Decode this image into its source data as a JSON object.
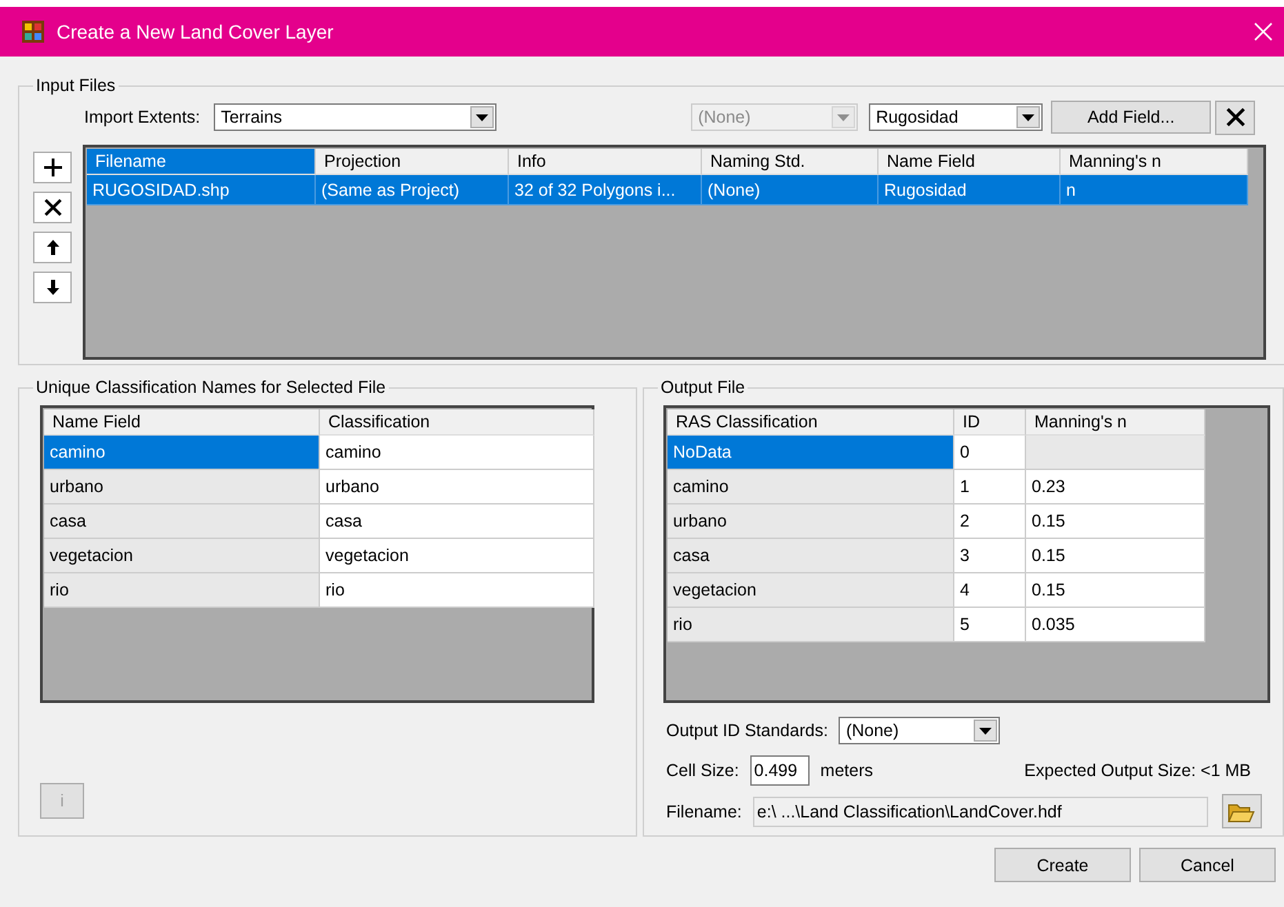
{
  "window": {
    "title": "Create a New Land Cover Layer"
  },
  "input_files": {
    "title": "Input Files",
    "import_extents": {
      "label": "Import Extents:",
      "value": "Terrains"
    },
    "naming_std": {
      "value": "(None)",
      "disabled": true
    },
    "name_field": {
      "value": "Rugosidad",
      "disabled": false
    },
    "add_field_button": "Add Field...",
    "columns": [
      {
        "label": "Filename",
        "selected": true
      },
      {
        "label": "Projection",
        "selected": false
      },
      {
        "label": "Info",
        "selected": false
      },
      {
        "label": "Naming Std.",
        "selected": false
      },
      {
        "label": "Name Field",
        "selected": false
      },
      {
        "label": "Manning's n",
        "selected": false
      }
    ],
    "rows": [
      {
        "cells": [
          "RUGOSIDAD.shp",
          "(Same as Project)",
          "32 of 32 Polygons i...",
          "(None)",
          "Rugosidad",
          "n"
        ],
        "selected": true
      }
    ]
  },
  "classification_names": {
    "title": "Unique Classification Names for Selected File",
    "columns": [
      "Name Field",
      "Classification"
    ],
    "rows": [
      {
        "cells": [
          "camino",
          "camino"
        ],
        "selected": true
      },
      {
        "cells": [
          "urbano",
          "urbano"
        ],
        "selected": false
      },
      {
        "cells": [
          "casa",
          "casa"
        ],
        "selected": false
      },
      {
        "cells": [
          "vegetacion",
          "vegetacion"
        ],
        "selected": false
      },
      {
        "cells": [
          "rio",
          "rio"
        ],
        "selected": false
      }
    ],
    "info_button": {
      "label": "i",
      "disabled": true
    }
  },
  "output_file": {
    "title": "Output File",
    "columns": [
      "RAS Classification",
      "ID",
      "Manning's n"
    ],
    "rows": [
      {
        "cells": [
          "NoData",
          "0",
          ""
        ],
        "selected": true
      },
      {
        "cells": [
          "camino",
          "1",
          "0.23"
        ],
        "selected": false
      },
      {
        "cells": [
          "urbano",
          "2",
          "0.15"
        ],
        "selected": false
      },
      {
        "cells": [
          "casa",
          "3",
          "0.15"
        ],
        "selected": false
      },
      {
        "cells": [
          "vegetacion",
          "4",
          "0.15"
        ],
        "selected": false
      },
      {
        "cells": [
          "rio",
          "5",
          "0.035"
        ],
        "selected": false
      }
    ],
    "output_id_standards": {
      "label": "Output ID Standards:",
      "value": "(None)"
    },
    "cell_size": {
      "label": "Cell Size:",
      "value": "0.499",
      "unit": "meters"
    },
    "expected_size": "Expected Output Size: <1 MB",
    "filename": {
      "label": "Filename:",
      "value": "e:\\ ...\\Land Classification\\LandCover.hdf"
    }
  },
  "buttons": [
    "Create",
    "Cancel"
  ]
}
